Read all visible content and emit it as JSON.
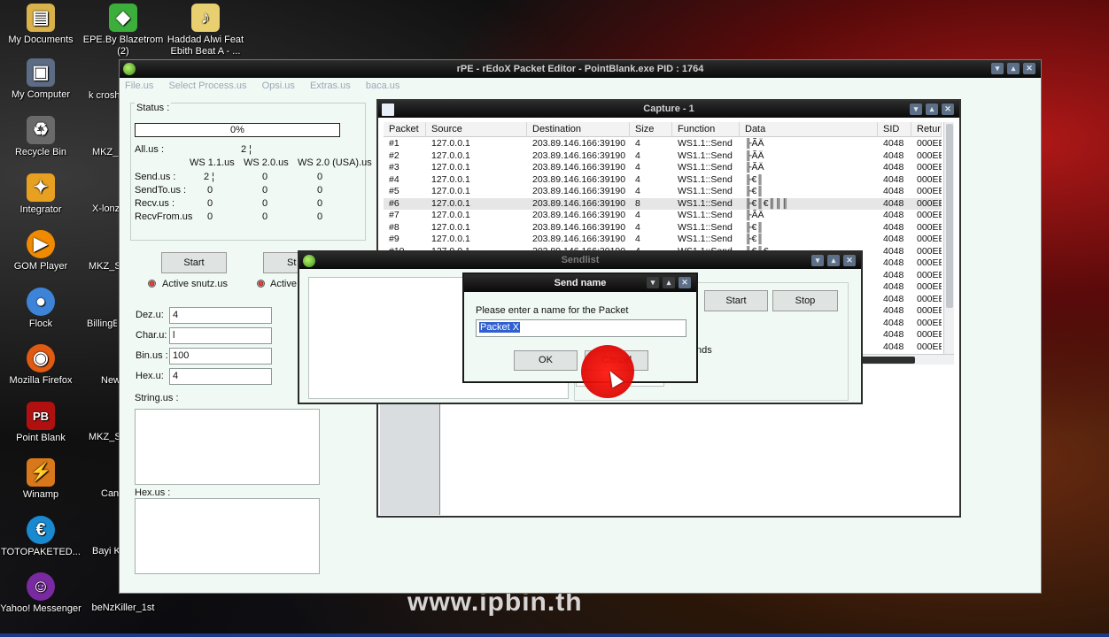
{
  "desktop": {
    "icons": [
      {
        "label": "My Documents",
        "color": "#d9b24a",
        "glyph": "📁"
      },
      {
        "label": "EPE.By Blazetrom (2)",
        "color": "#3cae3c",
        "glyph": "◆"
      },
      {
        "label": "Haddad Alwi Feat Ebith Beat A - ...",
        "color": "#e8d070",
        "glyph": "♪"
      },
      {
        "label": "My Computer",
        "color": "#5b6c84",
        "glyph": "▣"
      },
      {
        "label": "Recycle Bin",
        "color": "#6a6a6a",
        "glyph": "♻"
      },
      {
        "label": "Integrator",
        "color": "#e8a020",
        "glyph": "✦"
      },
      {
        "label": "GOM Player",
        "color": "#f08a00",
        "glyph": "▶"
      },
      {
        "label": "Flock",
        "color": "#3d84d8",
        "glyph": "●"
      },
      {
        "label": "Mozilla Firefox",
        "color": "#e05a12",
        "glyph": "◉"
      },
      {
        "label": "Point Blank",
        "color": "#b11010",
        "glyph": "PB"
      },
      {
        "label": "Winamp",
        "color": "#d8781a",
        "glyph": "⚡"
      },
      {
        "label": "TOTOPAKETED...",
        "color": "#1a8ad0",
        "glyph": "€"
      },
      {
        "label": "Yahoo! Messenger",
        "color": "#7a2aa0",
        "glyph": "☺"
      }
    ],
    "partial_icons": [
      "k crosha",
      "MKZ_",
      "X-lonz",
      "MKZ_S",
      "BillingEi DeskP",
      "New Doc",
      "MKZ_S",
      "Can",
      "Bayi K",
      "beNzKiller_1st"
    ],
    "watermark": "www.ipbin.th"
  },
  "main_window": {
    "title": "rPE - rEdoX Packet Editor - PointBlank.exe PID : 1764",
    "menu": [
      "File.us",
      "Select Process.us",
      "Opsi.us",
      "Extras.us",
      "baca.us"
    ],
    "status": {
      "title": "Status :",
      "progress_text": "0%",
      "progress": 0,
      "all_label": "All.us :",
      "all_value": "2 ¦",
      "col_headers": [
        "WS 1.1.us",
        "WS 2.0.us",
        "WS 2.0 (USA).us"
      ],
      "rows": [
        {
          "label": "Send.us :",
          "values": [
            "2 ¦",
            "0",
            "0"
          ]
        },
        {
          "label": "SendTo.us :",
          "values": [
            "0",
            "0",
            "0"
          ]
        },
        {
          "label": "Recv.us :",
          "values": [
            "0",
            "0",
            "0"
          ]
        },
        {
          "label": "RecvFrom.us",
          "values": [
            "0",
            "0",
            "0"
          ]
        }
      ]
    },
    "start_label": "Start",
    "stop_label_partial": "St",
    "active_snutz": "Active snutz.us",
    "active_partial": "Active",
    "fields": [
      {
        "label": "Dez.u:",
        "value": "4"
      },
      {
        "label": "Char.u:",
        "value": "l"
      },
      {
        "label": "Bin.us :",
        "value": "100"
      },
      {
        "label": "Hex.u:",
        "value": "4"
      }
    ],
    "string_label": "String.us :",
    "hex_label": "Hex.us :"
  },
  "capture": {
    "title": "Capture - 1",
    "columns": [
      "Packet",
      "Source",
      "Destination",
      "Size",
      "Function",
      "Data",
      "SID",
      "Return"
    ],
    "rows": [
      [
        "#1",
        "127.0.0.1",
        "203.89.146.166:39190",
        "4",
        "WS1.1::Send",
        "╟ÃÄ",
        "4048",
        "000EE"
      ],
      [
        "#2",
        "127.0.0.1",
        "203.89.146.166:39190",
        "4",
        "WS1.1::Send",
        "╟ÃÄ",
        "4048",
        "000EE"
      ],
      [
        "#3",
        "127.0.0.1",
        "203.89.146.166:39190",
        "4",
        "WS1.1::Send",
        "╟ÃÄ",
        "4048",
        "000EE"
      ],
      [
        "#4",
        "127.0.0.1",
        "203.89.146.166:39190",
        "4",
        "WS1.1::Send",
        "╟€║",
        "4048",
        "000EE"
      ],
      [
        "#5",
        "127.0.0.1",
        "203.89.146.166:39190",
        "4",
        "WS1.1::Send",
        "╟€║",
        "4048",
        "000EE"
      ],
      [
        "#6",
        "127.0.0.1",
        "203.89.146.166:39190",
        "8",
        "WS1.1::Send",
        "╟€║€║║║",
        "4048",
        "000EE"
      ],
      [
        "#7",
        "127.0.0.1",
        "203.89.146.166:39190",
        "4",
        "WS1.1::Send",
        "╟ÃÄ",
        "4048",
        "000EE"
      ],
      [
        "#8",
        "127.0.0.1",
        "203.89.146.166:39190",
        "4",
        "WS1.1::Send",
        "╟€║",
        "4048",
        "000EE"
      ],
      [
        "#9",
        "127.0.0.1",
        "203.89.146.166:39190",
        "4",
        "WS1.1::Send",
        "╟€║",
        "4048",
        "000EE"
      ],
      [
        "#10",
        "127.0.0.1",
        "203.89.146.166:39190",
        "4",
        "WS1.1::Send",
        "╟€║€",
        "4048",
        "000EE"
      ]
    ],
    "extra_sid_rows": [
      "4048",
      "4048",
      "4048",
      "4048",
      "4048",
      "4048",
      "4048",
      "4048"
    ],
    "extra_return_rows": [
      "000EE",
      "000EE",
      "000EE",
      "000EE",
      "000EE",
      "000EE",
      "000EE",
      "000EE"
    ],
    "selected_row": 5
  },
  "sendlist": {
    "title": "Sendlist",
    "start_label": "Start",
    "stop_label": "Stop",
    "partial_text": "nds"
  },
  "dialog": {
    "title": "Send name",
    "prompt": "Please enter a name for the Packet",
    "value": "Packet X",
    "ok_label": "OK",
    "cancel_label": "Cancel"
  }
}
